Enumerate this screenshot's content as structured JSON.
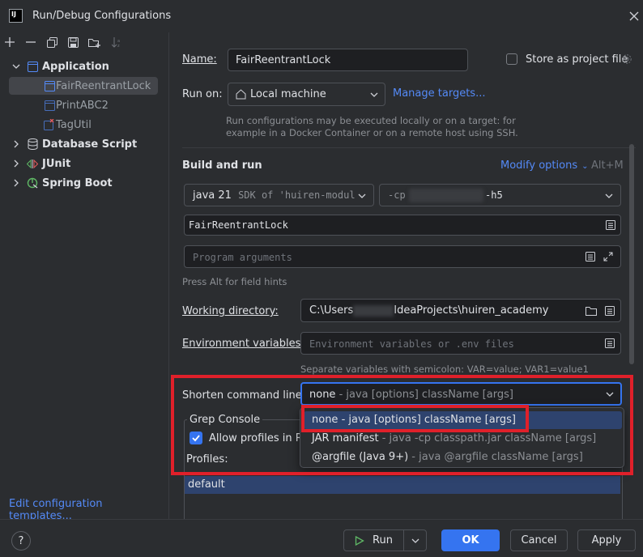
{
  "window": {
    "app_icon_text": "IJ",
    "title": "Run/Debug Configurations"
  },
  "toolbar": {
    "icons": [
      "add-icon",
      "remove-icon",
      "copy-icon",
      "save-icon",
      "folder-icon",
      "sort-icon"
    ]
  },
  "tree": {
    "application": "Application",
    "items": [
      {
        "label": "FairReentrantLock"
      },
      {
        "label": "PrintABC2"
      },
      {
        "label": "TagUtil"
      }
    ],
    "database_script": "Database Script",
    "junit": "JUnit",
    "spring_boot": "Spring Boot"
  },
  "edit_templates": "Edit configuration templates...",
  "form": {
    "name_label": "Name:",
    "name_value": "FairReentrantLock",
    "store_label": "Store as project file",
    "run_on_label": "Run on:",
    "run_on_value": "Local machine",
    "manage_targets": "Manage targets...",
    "run_on_hint_1": "Run configurations may be executed locally or on a target: for",
    "run_on_hint_2": "example in a Docker Container or on a remote host using SSH.",
    "build_run_title": "Build and run",
    "modify_options": "Modify options",
    "modify_shortcut": "Alt+M",
    "sdk_java": "java 21",
    "sdk_detail": "SDK of 'huiren-modul",
    "cp_prefix": "-cp",
    "cp_suffix": "-h5",
    "main_class": "FairReentrantLock",
    "program_args_placeholder": "Program arguments",
    "field_hints": "Press Alt for field hints",
    "working_dir_label": "Working directory:",
    "working_dir_prefix": "C:\\Users",
    "working_dir_suffix": "IdeaProjects\\huiren_academy",
    "env_label": "Environment variables:",
    "env_placeholder": "Environment variables or .env files",
    "env_hint": "Separate variables with semicolon: VAR=value; VAR1=value1",
    "shorten_label": "Shorten command line:",
    "shorten_value_main": "none",
    "shorten_value_detail": " - java [options] className [args]",
    "grep_console": "Grep Console",
    "allow_profiles": "Allow profiles in Ru",
    "profiles_label": "Profiles:",
    "profile_selected": "default"
  },
  "dropdown": {
    "options": [
      {
        "main": "none - java [options] className [args]",
        "detail": ""
      },
      {
        "main": "JAR manifest",
        "detail": " - java -cp classpath.jar className [args]"
      },
      {
        "main": "@argfile (Java 9+)",
        "detail": " - java @argfile className [args]"
      }
    ]
  },
  "footer": {
    "help": "?",
    "run": "Run",
    "ok": "OK",
    "cancel": "Cancel",
    "apply": "Apply"
  },
  "colors": {
    "accent": "#3574f0",
    "link": "#548af7",
    "highlight_border": "#e0202a",
    "selected_row": "#2e436e"
  }
}
